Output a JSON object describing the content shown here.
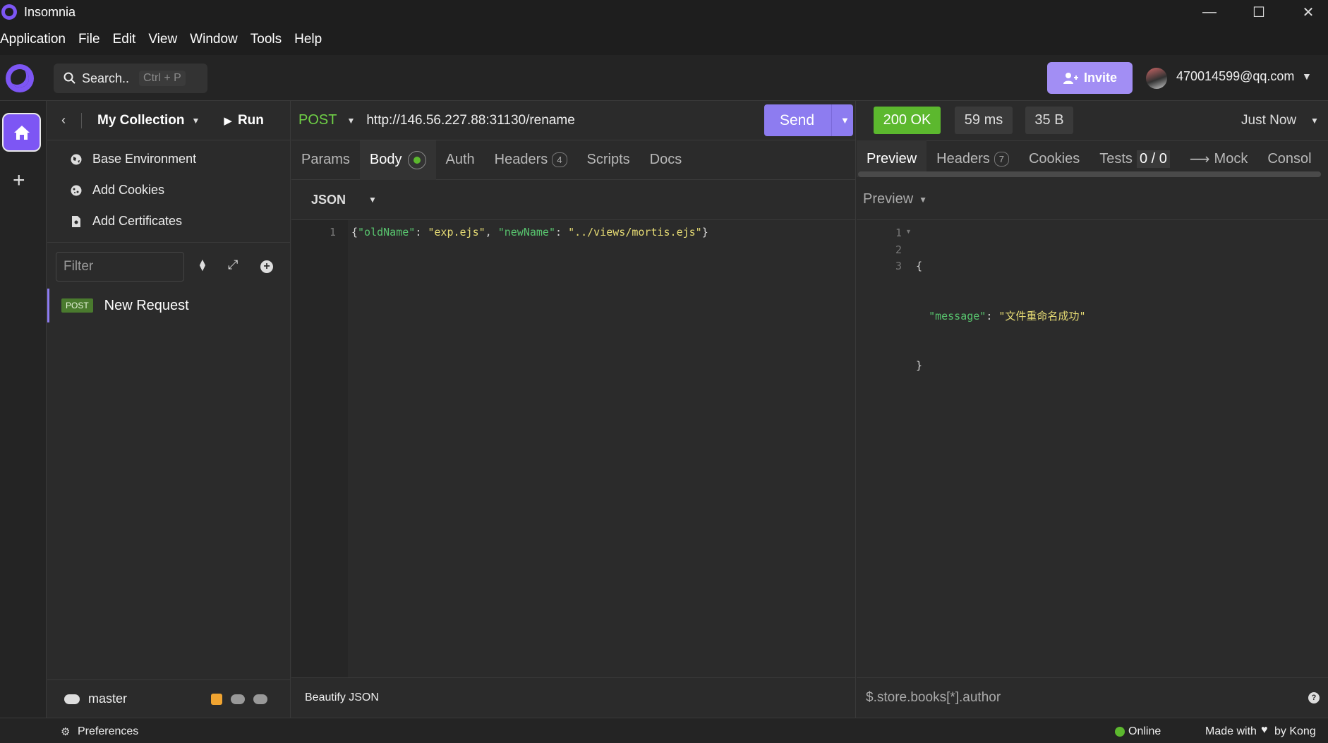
{
  "window": {
    "title": "Insomnia",
    "minimize": "—",
    "maximize": "☐",
    "close": "✕"
  },
  "menu": [
    "Application",
    "File",
    "Edit",
    "View",
    "Window",
    "Tools",
    "Help"
  ],
  "header": {
    "search_placeholder": "Search..",
    "search_shortcut": "Ctrl + P",
    "invite_label": "Invite",
    "user_email": "470014599@qq.com"
  },
  "sidebar": {
    "collection_name": "My Collection",
    "run_label": "Run",
    "items": [
      {
        "label": "Base Environment",
        "icon": "globe-icon"
      },
      {
        "label": "Add Cookies",
        "icon": "cookie-icon"
      },
      {
        "label": "Add Certificates",
        "icon": "certificate-icon"
      }
    ],
    "filter_placeholder": "Filter",
    "requests": [
      {
        "method": "POST",
        "name": "New Request"
      }
    ],
    "branch": "master"
  },
  "request": {
    "method": "POST",
    "url": "http://146.56.227.88:31130/rename",
    "send_label": "Send",
    "tabs": [
      "Params",
      "Body",
      "Auth",
      "Headers",
      "Scripts",
      "Docs"
    ],
    "headers_count": "4",
    "body_type": "JSON",
    "body_line_number": "1",
    "body": {
      "key1": "\"oldName\"",
      "val1": "\"exp.ejs\"",
      "key2": "\"newName\"",
      "val2": "\"../views/mortis.ejs\""
    },
    "footer_label": "Beautify JSON"
  },
  "response": {
    "status": "200 OK",
    "time": "59 ms",
    "size": "35 B",
    "timestamp": "Just Now",
    "tabs": [
      "Preview",
      "Headers",
      "Cookies",
      "Tests",
      "Mock",
      "Consol"
    ],
    "headers_count": "7",
    "tests_count": "0 / 0",
    "preview_mode": "Preview",
    "lines": [
      "1",
      "2",
      "3"
    ],
    "json_key": "\"message\"",
    "json_value": "\"文件重命名成功\"",
    "filter_placeholder": "$.store.books[*].author"
  },
  "status_bar": {
    "preferences_label": "Preferences",
    "online_label": "Online",
    "made_with": "Made with",
    "by_kong": "by Kong"
  },
  "colors": {
    "accent": "#8d7cf0",
    "success": "#5cb82e",
    "method_post": "#6fd046"
  }
}
